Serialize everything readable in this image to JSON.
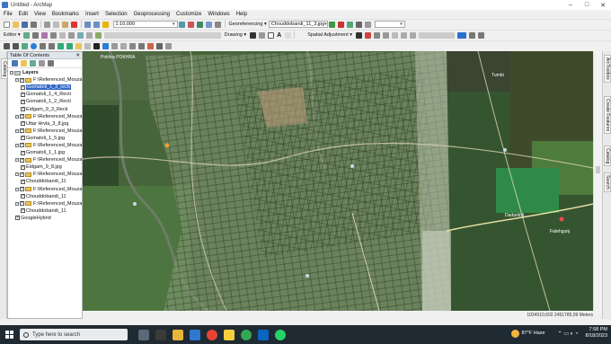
{
  "window": {
    "title": "Untitled - ArcMap",
    "controls": [
      "–",
      "□",
      "✕"
    ]
  },
  "menu": [
    "File",
    "Edit",
    "View",
    "Bookmarks",
    "Insert",
    "Selection",
    "Geoprocessing",
    "Customize",
    "Windows",
    "Help"
  ],
  "toolbar": {
    "scale": "1:10,000",
    "georef_label": "Georeferencing ▾",
    "georef_layer": "Chouddobandi_11_3.jpg",
    "editor_label": "Editor ▾",
    "drawing_label": "Drawing ▾",
    "spatial_adj_label": "Spatial Adjustment ▾",
    "font_a": "A"
  },
  "toc": {
    "title": "Table Of Contents",
    "close": "✕",
    "layers_label": "Layers",
    "items": [
      {
        "label": "F:\\Referenced_Mouza\\G",
        "level": 1,
        "type": "folder"
      },
      {
        "label": "Gomatoli_1_3_recti",
        "level": 2,
        "type": "layer",
        "selected": true
      },
      {
        "label": "Gomatoli_1_4_Recti",
        "level": 2,
        "type": "layer"
      },
      {
        "label": "Gomatoli_1_2_Recti",
        "level": 2,
        "type": "layer"
      },
      {
        "label": "Eidgam_9_3_Recti",
        "level": 2,
        "type": "layer"
      },
      {
        "label": "F:\\Referenced_Mouza\\",
        "level": 1,
        "type": "folder"
      },
      {
        "label": "Uttar Hrvla_3_8.jpg",
        "level": 2,
        "type": "layer"
      },
      {
        "label": "F:\\Referenced_Mouza\\",
        "level": 1,
        "type": "folder"
      },
      {
        "label": "Gomatoli_1_5.jpg",
        "level": 2,
        "type": "layer"
      },
      {
        "label": "F:\\Referenced_Mouza\\",
        "level": 1,
        "type": "folder"
      },
      {
        "label": "Gomatoli_1_1.jpg",
        "level": 2,
        "type": "layer"
      },
      {
        "label": "F:\\Referenced_Mouza\\",
        "level": 1,
        "type": "folder"
      },
      {
        "label": "Eidgam_9_8.jpg",
        "level": 2,
        "type": "layer"
      },
      {
        "label": "F:\\Referenced_Mouza\\",
        "level": 1,
        "type": "folder"
      },
      {
        "label": "Chouddobandi_11",
        "level": 2,
        "type": "layer"
      },
      {
        "label": "F:\\Referenced_Mouza\\",
        "level": 1,
        "type": "folder"
      },
      {
        "label": "Chouddobandi_11",
        "level": 2,
        "type": "layer"
      },
      {
        "label": "F:\\Referenced_Mouza\\",
        "level": 1,
        "type": "folder"
      },
      {
        "label": "Chouddobandi_11",
        "level": 2,
        "type": "layer"
      },
      {
        "label": "GoogleHybrid",
        "level": 1,
        "type": "layer"
      }
    ]
  },
  "side_tabs_left": [
    "Catalog"
  ],
  "side_tabs_right": [
    "ArcToolbox",
    "Create Features",
    "Catalog",
    "Search"
  ],
  "map_labels": [
    "Pokhra POKHRA",
    "Tumbi",
    "Dadarkhli",
    "Fatehgunj"
  ],
  "status": {
    "coords": "1024510,602 2451785,09 Meters"
  },
  "taskbar": {
    "search_placeholder": "Type here to search",
    "weather": "87°F Haze",
    "time": "7:58 PM",
    "date": "8/18/2023"
  },
  "colors": {
    "accent": "#3369c6",
    "taskbar": "#1f2a33"
  }
}
